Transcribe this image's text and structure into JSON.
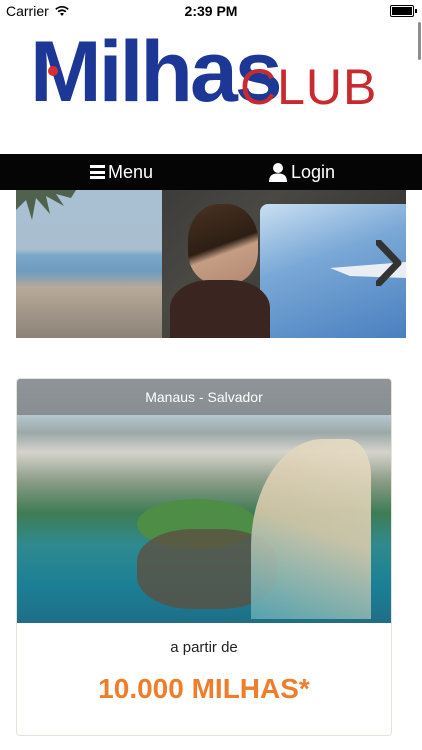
{
  "status_bar": {
    "carrier": "Carrier",
    "time": "2:39 PM"
  },
  "logo": {
    "text_main": "Milhas",
    "text_club": "CLUB",
    "colors": {
      "main": "#1c3795",
      "club": "#c92a2f",
      "dot": "#d72d33"
    }
  },
  "nav": {
    "menu_label": "Menu",
    "login_label": "Login",
    "menu_icon": "hamburger-icon",
    "login_icon": "user-icon"
  },
  "slider": {
    "next_icon": "chevron-right-icon"
  },
  "card": {
    "route": "Manaus - Salvador",
    "from_label": "a partir de",
    "price": "10.000 MILHAS*",
    "price_color": "#ef7e2c"
  }
}
